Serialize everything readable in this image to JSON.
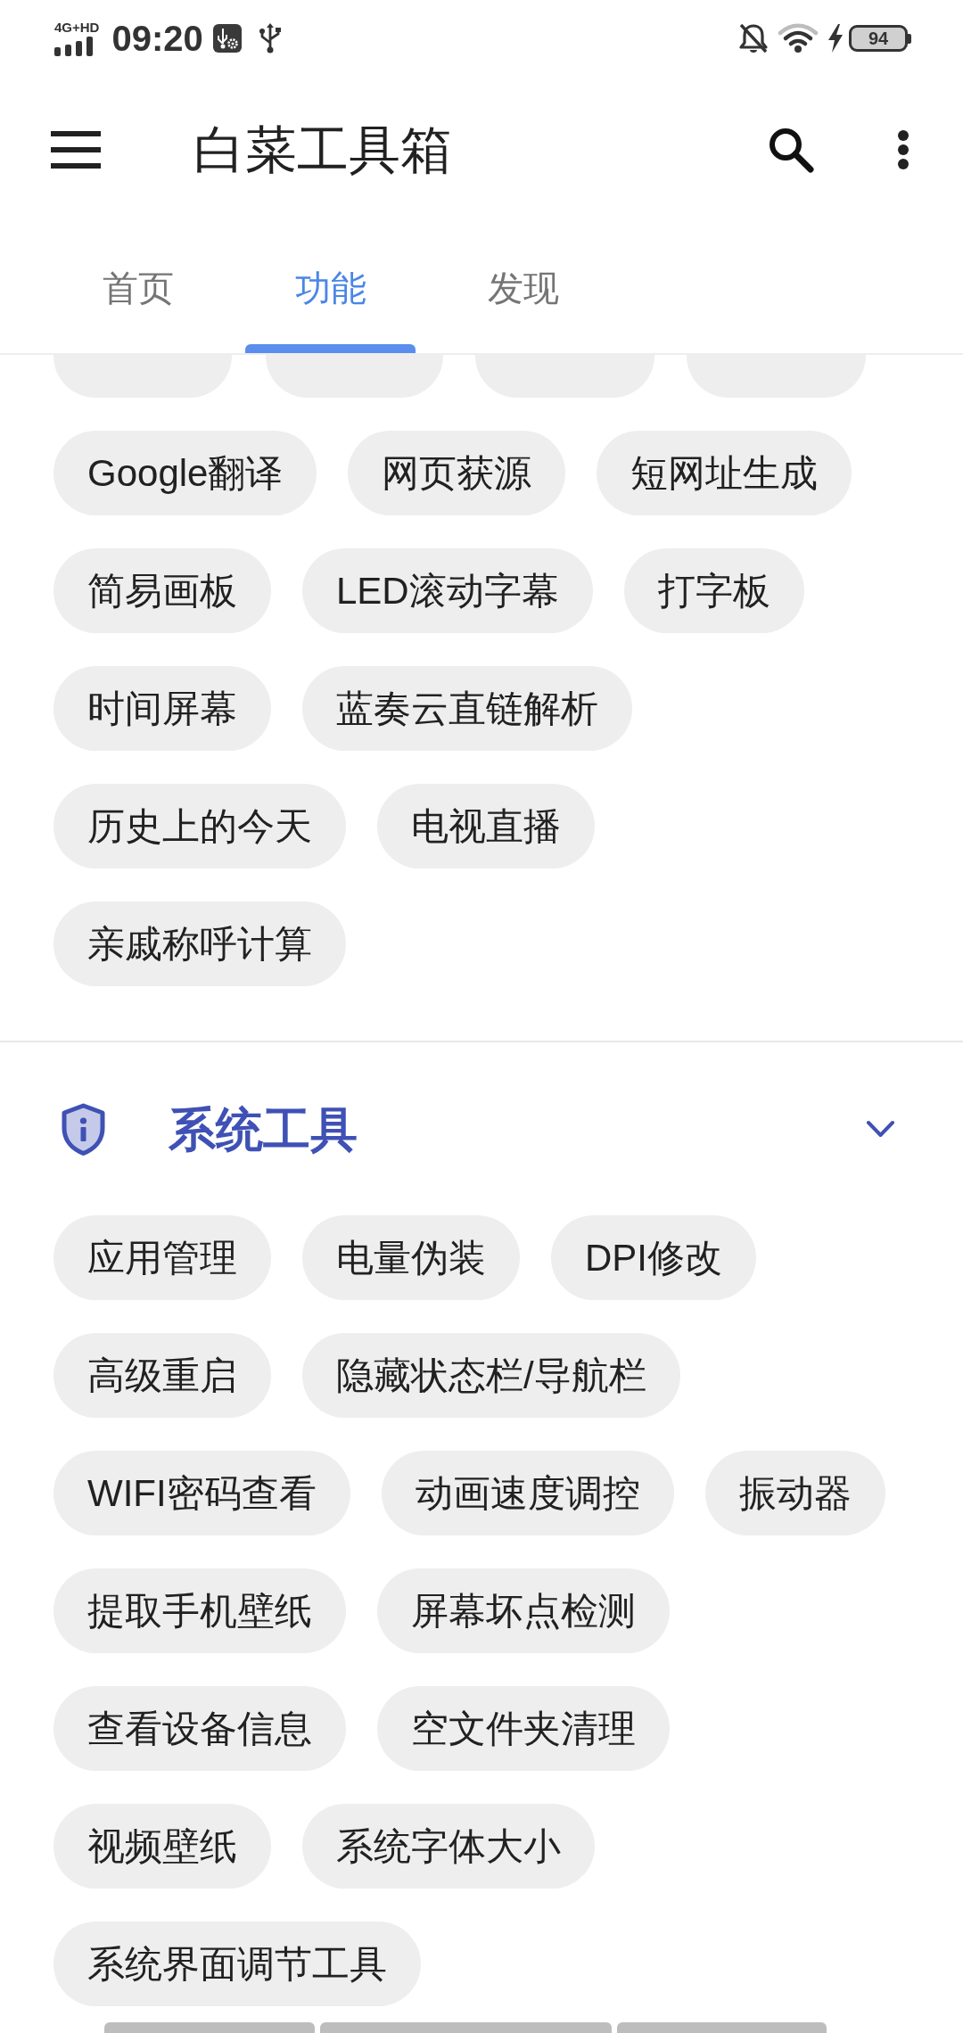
{
  "status_bar": {
    "network": "4G+HD",
    "time": "09:20",
    "battery": "94"
  },
  "app_bar": {
    "title": "白菜工具箱"
  },
  "tabs": [
    {
      "label": "首页",
      "selected": false
    },
    {
      "label": "功能",
      "selected": true
    },
    {
      "label": "发现",
      "selected": false
    }
  ],
  "sections": [
    {
      "chip_rows": [
        [
          "Google翻译",
          "网页获源",
          "短网址生成"
        ],
        [
          "简易画板",
          "LED滚动字幕",
          "打字板"
        ],
        [
          "时间屏幕",
          "蓝奏云直链解析"
        ],
        [
          "历史上的今天",
          "电视直播"
        ],
        [
          "亲戚称呼计算"
        ]
      ]
    },
    {
      "title": "系统工具",
      "expanded": true,
      "chip_rows": [
        [
          "应用管理",
          "电量伪装",
          "DPI修改"
        ],
        [
          "高级重启",
          "隐藏状态栏/导航栏"
        ],
        [
          "WIFI密码查看",
          "动画速度调控",
          "振动器"
        ],
        [
          "提取手机壁纸",
          "屏幕坏点检测"
        ],
        [
          "查看设备信息",
          "空文件夹清理"
        ],
        [
          "视频壁纸",
          "系统字体大小"
        ],
        [
          "系统界面调节工具"
        ]
      ]
    }
  ]
}
